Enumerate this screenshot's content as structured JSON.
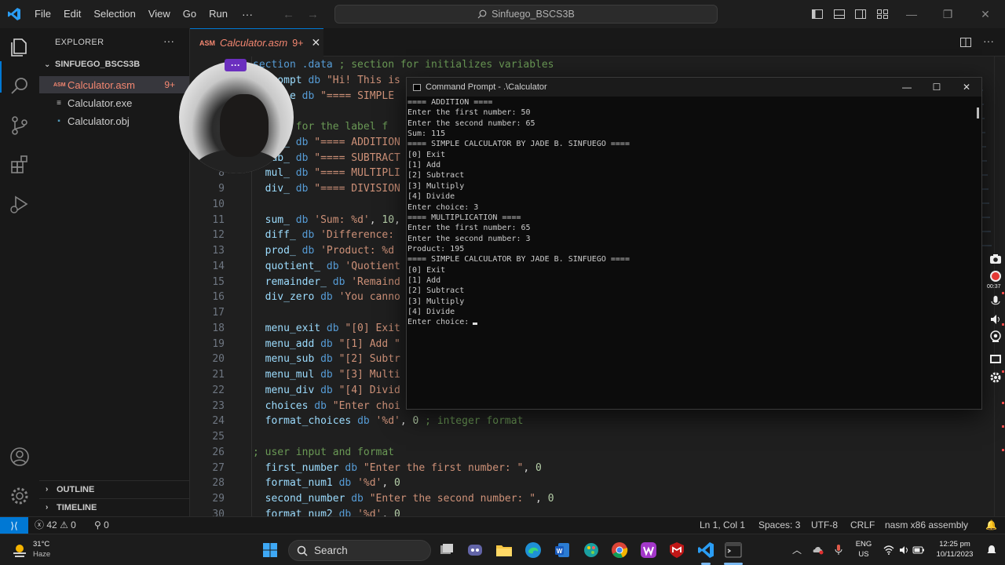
{
  "menu": [
    "File",
    "Edit",
    "Selection",
    "View",
    "Go",
    "Run"
  ],
  "menu_more": "···",
  "command_center": "Sinfuego_BSCS3B",
  "sidebar": {
    "header": "EXPLORER",
    "header_more": "···",
    "folder": "SINFUEGO_BSCS3B",
    "files": [
      {
        "name": "Calculator.asm",
        "badge": "9+",
        "icon": "ASM"
      },
      {
        "name": "Calculator.exe",
        "badge": "",
        "icon": "≡"
      },
      {
        "name": "Calculator.obj",
        "badge": "",
        "icon": "▪"
      }
    ],
    "outline": "OUTLINE",
    "timeline": "TIMELINE"
  },
  "tab": {
    "icon": "ASM",
    "name": "Calculator.asm",
    "badge": "9+",
    "close": "✕"
  },
  "code_lines": [
    {
      "n": "",
      "parts": [
        {
          "c": "dir",
          "t": "section .data "
        },
        {
          "c": "cmt",
          "t": "; section for initializes variables"
        }
      ]
    },
    {
      "n": "",
      "parts": [
        {
          "c": "kw",
          "t": "  prompt "
        },
        {
          "c": "dir",
          "t": "db "
        },
        {
          "c": "str",
          "t": "\"Hi! This is"
        }
      ]
    },
    {
      "n": "",
      "parts": [
        {
          "c": "kw",
          "t": "  title "
        },
        {
          "c": "dir",
          "t": "db "
        },
        {
          "c": "str",
          "t": "\"==== SIMPLE"
        }
      ]
    },
    {
      "n": "",
      "parts": [
        {
          "c": "plain",
          "t": ""
        }
      ]
    },
    {
      "n": "",
      "parts": [
        {
          "c": "cmt",
          "t": "  ; is for the label f"
        }
      ]
    },
    {
      "n": "",
      "parts": [
        {
          "c": "kw",
          "t": "  add_ "
        },
        {
          "c": "dir",
          "t": "db "
        },
        {
          "c": "str",
          "t": "\"==== ADDITION"
        }
      ]
    },
    {
      "n": "",
      "parts": [
        {
          "c": "kw",
          "t": "  sub_ "
        },
        {
          "c": "dir",
          "t": "db "
        },
        {
          "c": "str",
          "t": "\"==== SUBTRACT"
        }
      ]
    },
    {
      "n": "8",
      "parts": [
        {
          "c": "kw",
          "t": "  mul_ "
        },
        {
          "c": "dir",
          "t": "db "
        },
        {
          "c": "str",
          "t": "\"==== MULTIPLI"
        }
      ]
    },
    {
      "n": "9",
      "parts": [
        {
          "c": "kw",
          "t": "  div_ "
        },
        {
          "c": "dir",
          "t": "db "
        },
        {
          "c": "str",
          "t": "\"==== DIVISION"
        }
      ]
    },
    {
      "n": "10",
      "parts": [
        {
          "c": "plain",
          "t": ""
        }
      ]
    },
    {
      "n": "11",
      "parts": [
        {
          "c": "kw",
          "t": "  sum_ "
        },
        {
          "c": "dir",
          "t": "db "
        },
        {
          "c": "str",
          "t": "'Sum: %d'"
        },
        {
          "c": "plain",
          "t": ", "
        },
        {
          "c": "num",
          "t": "10"
        },
        {
          "c": "plain",
          "t": ","
        }
      ]
    },
    {
      "n": "12",
      "parts": [
        {
          "c": "kw",
          "t": "  diff_ "
        },
        {
          "c": "dir",
          "t": "db "
        },
        {
          "c": "str",
          "t": "'Difference:"
        }
      ]
    },
    {
      "n": "13",
      "parts": [
        {
          "c": "kw",
          "t": "  prod_ "
        },
        {
          "c": "dir",
          "t": "db "
        },
        {
          "c": "str",
          "t": "'Product: %d"
        }
      ]
    },
    {
      "n": "14",
      "parts": [
        {
          "c": "kw",
          "t": "  quotient_ "
        },
        {
          "c": "dir",
          "t": "db "
        },
        {
          "c": "str",
          "t": "'Quotient"
        }
      ]
    },
    {
      "n": "15",
      "parts": [
        {
          "c": "kw",
          "t": "  remainder_ "
        },
        {
          "c": "dir",
          "t": "db "
        },
        {
          "c": "str",
          "t": "'Remaind"
        }
      ]
    },
    {
      "n": "16",
      "parts": [
        {
          "c": "kw",
          "t": "  div_zero "
        },
        {
          "c": "dir",
          "t": "db "
        },
        {
          "c": "str",
          "t": "'You canno"
        }
      ]
    },
    {
      "n": "17",
      "parts": [
        {
          "c": "plain",
          "t": ""
        }
      ]
    },
    {
      "n": "18",
      "parts": [
        {
          "c": "kw",
          "t": "  menu_exit "
        },
        {
          "c": "dir",
          "t": "db "
        },
        {
          "c": "str",
          "t": "\"[0] Exit"
        }
      ]
    },
    {
      "n": "19",
      "parts": [
        {
          "c": "kw",
          "t": "  menu_add "
        },
        {
          "c": "dir",
          "t": "db "
        },
        {
          "c": "str",
          "t": "\"[1] Add \""
        }
      ]
    },
    {
      "n": "20",
      "parts": [
        {
          "c": "kw",
          "t": "  menu_sub "
        },
        {
          "c": "dir",
          "t": "db "
        },
        {
          "c": "str",
          "t": "\"[2] Subtr"
        }
      ]
    },
    {
      "n": "21",
      "parts": [
        {
          "c": "kw",
          "t": "  menu_mul "
        },
        {
          "c": "dir",
          "t": "db "
        },
        {
          "c": "str",
          "t": "\"[3] Multi"
        }
      ]
    },
    {
      "n": "22",
      "parts": [
        {
          "c": "kw",
          "t": "  menu_div "
        },
        {
          "c": "dir",
          "t": "db "
        },
        {
          "c": "str",
          "t": "\"[4] Divid"
        }
      ]
    },
    {
      "n": "23",
      "parts": [
        {
          "c": "kw",
          "t": "  choices "
        },
        {
          "c": "dir",
          "t": "db "
        },
        {
          "c": "str",
          "t": "\"Enter choi"
        }
      ]
    },
    {
      "n": "24",
      "parts": [
        {
          "c": "kw",
          "t": "  format_choices "
        },
        {
          "c": "dir",
          "t": "db "
        },
        {
          "c": "str",
          "t": "'%d'"
        },
        {
          "c": "plain",
          "t": ", "
        },
        {
          "c": "num",
          "t": "0"
        },
        {
          "c": "cmt",
          "t": " ; integer format"
        }
      ]
    },
    {
      "n": "25",
      "parts": [
        {
          "c": "plain",
          "t": ""
        }
      ]
    },
    {
      "n": "26",
      "parts": [
        {
          "c": "cmt",
          "t": "; user input and format"
        }
      ]
    },
    {
      "n": "27",
      "parts": [
        {
          "c": "kw",
          "t": "  first_number "
        },
        {
          "c": "dir",
          "t": "db "
        },
        {
          "c": "str",
          "t": "\"Enter the first number: \""
        },
        {
          "c": "plain",
          "t": ", "
        },
        {
          "c": "num",
          "t": "0"
        }
      ]
    },
    {
      "n": "28",
      "parts": [
        {
          "c": "kw",
          "t": "  format_num1 "
        },
        {
          "c": "dir",
          "t": "db "
        },
        {
          "c": "str",
          "t": "'%d'"
        },
        {
          "c": "plain",
          "t": ", "
        },
        {
          "c": "num",
          "t": "0"
        }
      ]
    },
    {
      "n": "29",
      "parts": [
        {
          "c": "kw",
          "t": "  second_number "
        },
        {
          "c": "dir",
          "t": "db "
        },
        {
          "c": "str",
          "t": "\"Enter the second number: \""
        },
        {
          "c": "plain",
          "t": ", "
        },
        {
          "c": "num",
          "t": "0"
        }
      ]
    },
    {
      "n": "30",
      "parts": [
        {
          "c": "kw",
          "t": "  format_num2 "
        },
        {
          "c": "dir",
          "t": "db "
        },
        {
          "c": "str",
          "t": "'%d'"
        },
        {
          "c": "plain",
          "t": ", "
        },
        {
          "c": "num",
          "t": "0"
        }
      ]
    }
  ],
  "webcam_more": "···",
  "cmd": {
    "title": "Command Prompt - .\\Calculator",
    "minimize": "—",
    "maximize": "☐",
    "close": "✕",
    "lines": [
      "==== ADDITION ====",
      "Enter the first number: 50",
      "Enter the second number: 65",
      "Sum: 115",
      "==== SIMPLE CALCULATOR BY JADE B. SINFUEGO ====",
      "[0] Exit",
      "[1] Add",
      "[2] Subtract",
      "[3] Multiply",
      "[4] Divide",
      "Enter choice: 3",
      "==== MULTIPLICATION ====",
      "Enter the first number: 65",
      "Enter the second number: 3",
      "Product: 195",
      "==== SIMPLE CALCULATOR BY JADE B. SINFUEGO ====",
      "[0] Exit",
      "[1] Add",
      "[2] Subtract",
      "[3] Multiply",
      "[4] Divide",
      "Enter choice:"
    ]
  },
  "status": {
    "errors": "42",
    "warnings": "0",
    "ports": "0",
    "position": "Ln 1, Col 1",
    "spaces": "Spaces: 3",
    "encoding": "UTF-8",
    "eol": "CRLF",
    "language": "nasm x86 assembly"
  },
  "taskbar": {
    "weather_temp": "31°C",
    "weather_desc": "Haze",
    "search": "Search",
    "lang1": "ENG",
    "lang2": "US",
    "time": "12:25 pm",
    "date": "10/11/2023"
  },
  "recorder": {
    "timer": "00:37"
  },
  "colors": {
    "accent": "#0078d4",
    "error": "#f48771",
    "warning": "#cca700",
    "webcam_badge": "#6b2fbf"
  }
}
